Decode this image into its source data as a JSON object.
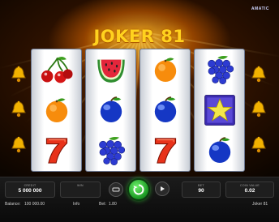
{
  "header": {
    "brand": "AMATIC",
    "title": "JOKER 81"
  },
  "reels": [
    [
      "cherries",
      "orange",
      "seven"
    ],
    [
      "watermelon",
      "plum",
      "grapes"
    ],
    [
      "orange",
      "plum",
      "seven"
    ],
    [
      "grapes",
      "star",
      "plum"
    ]
  ],
  "bells": [
    "bell-icon",
    "bell-icon",
    "bell-icon",
    "bell-icon",
    "bell-icon",
    "bell-icon"
  ],
  "panel": {
    "credit_label": "CREDIT",
    "credit_value": "5 000 000",
    "win_label": "WIN",
    "win_value": "",
    "bet_label": "BET",
    "bet_value": "90",
    "coin_label": "COIN VALUE",
    "coin_value": "0.02",
    "balance_label": "Balance:",
    "balance_value": "100 000.00",
    "info_label": "Info",
    "bet_footer_label": "Bet:",
    "bet_footer_value": "1.80",
    "game_name": "Joker 81"
  },
  "colors": {
    "title": "#ffd21e",
    "spin": "#2fbf3a"
  }
}
